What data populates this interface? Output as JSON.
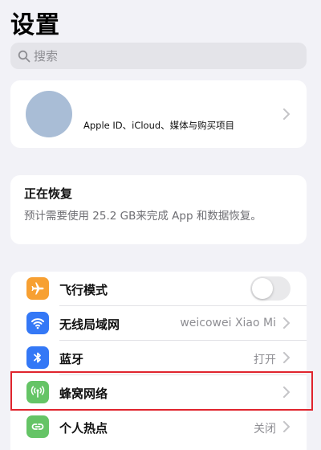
{
  "header": {
    "title": "设置"
  },
  "search": {
    "placeholder": "搜索",
    "icon": "magnifier"
  },
  "profile": {
    "label": "Apple ID、iCloud、媒体与购买项目",
    "avatar_color": "#a9bdd6"
  },
  "restore": {
    "title": "正在恢复",
    "description": "预计需要使用 25.2 GB来完成 App 和数据恢复。"
  },
  "settings": {
    "items": [
      {
        "label": "飞行模式",
        "icon": "airplane-icon",
        "icon_color": "#f7a032",
        "control": "toggle",
        "toggle_on": false
      },
      {
        "label": "无线局域网",
        "icon": "wifi-icon",
        "icon_color": "#3478f6",
        "value": "weicowei Xiao Mi"
      },
      {
        "label": "蓝牙",
        "icon": "bluetooth-icon",
        "icon_color": "#3478f6",
        "value": "打开"
      },
      {
        "label": "蜂窝网络",
        "icon": "cellular-icon",
        "icon_color": "#65c466",
        "value": "",
        "highlighted": true
      },
      {
        "label": "个人热点",
        "icon": "hotspot-icon",
        "icon_color": "#65c466",
        "value": "关闭"
      }
    ]
  },
  "colors": {
    "highlight_border": "#e0242d",
    "background": "#f2f2f7"
  }
}
